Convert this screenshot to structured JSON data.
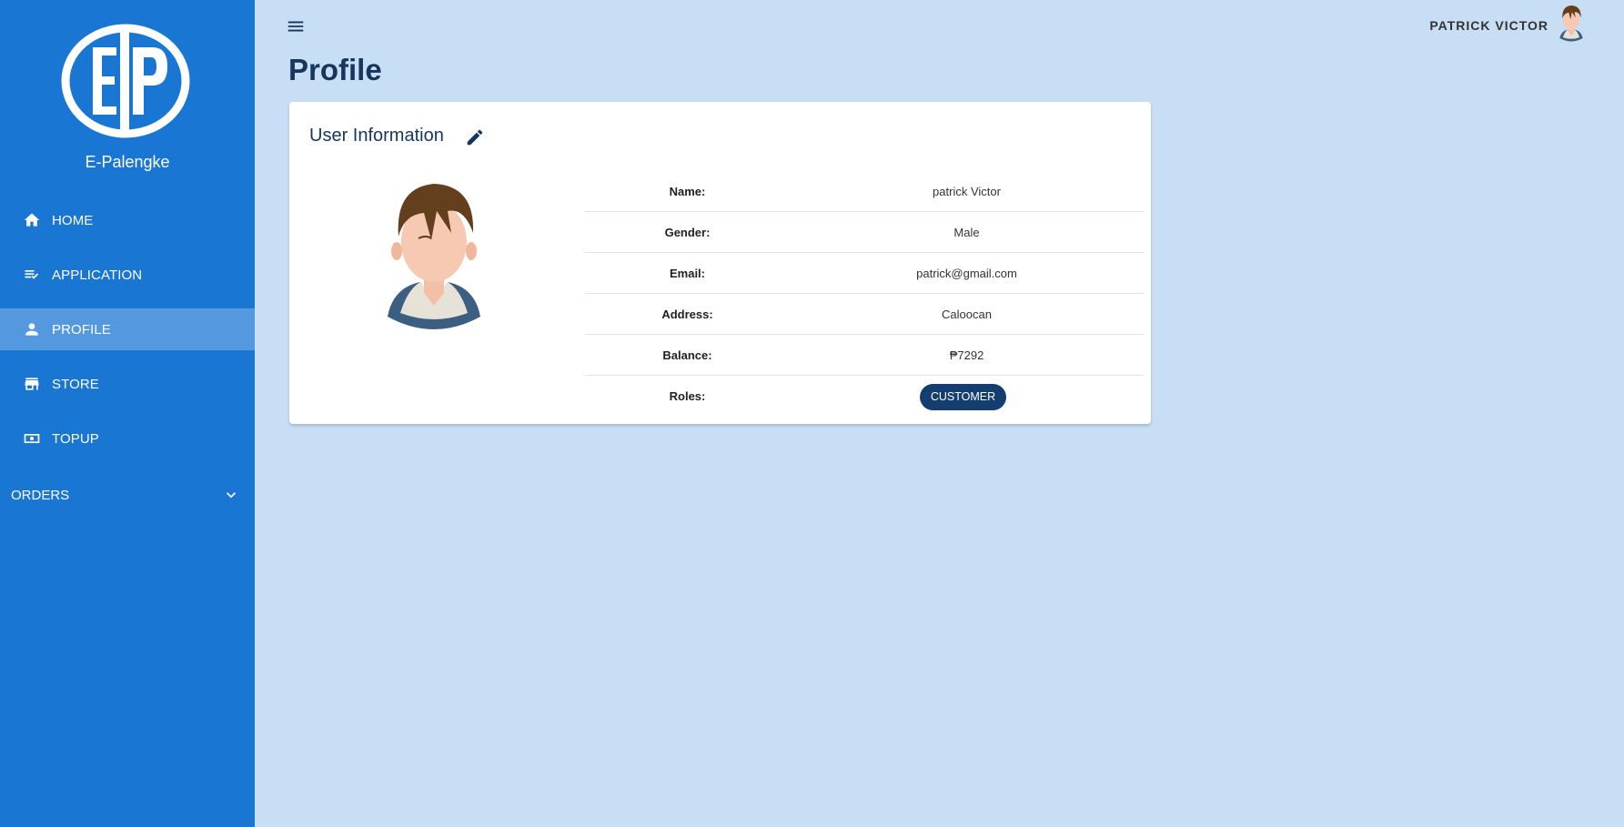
{
  "app": {
    "brand": "E-Palengke",
    "logo_text": "EP"
  },
  "sidebar": {
    "items": [
      {
        "label": "HOME",
        "icon": "home-icon",
        "active": false
      },
      {
        "label": "APPLICATION",
        "icon": "playlist-check-icon",
        "active": false
      },
      {
        "label": "PROFILE",
        "icon": "person-icon",
        "active": true
      },
      {
        "label": "STORE",
        "icon": "store-icon",
        "active": false
      },
      {
        "label": "TOPUP",
        "icon": "cash-icon",
        "active": false
      }
    ],
    "orders": {
      "label": "ORDERS",
      "icon": "chevron-down-icon",
      "expanded": false
    }
  },
  "header": {
    "user_name": "PATRICK VICTOR",
    "menu_icon": "hamburger-menu-icon"
  },
  "page": {
    "title": "Profile"
  },
  "card": {
    "title": "User Information",
    "edit_icon": "pencil-icon",
    "fields": [
      {
        "label": "Name:",
        "value": "patrick Victor"
      },
      {
        "label": "Gender:",
        "value": "Male"
      },
      {
        "label": "Email:",
        "value": "patrick@gmail.com"
      },
      {
        "label": "Address:",
        "value": "Caloocan"
      },
      {
        "label": "Balance:",
        "value": "₱7292"
      },
      {
        "label": "Roles:",
        "value": "CUSTOMER",
        "chip": true
      }
    ]
  },
  "colors": {
    "sidebar_bg": "#1976d2",
    "sidebar_active": "#5498e0",
    "page_bg": "#c8def4",
    "title_text": "#17365d",
    "role_chip": "#133e6f"
  }
}
